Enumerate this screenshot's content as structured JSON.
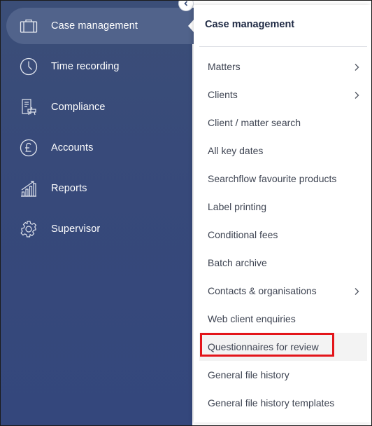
{
  "sidebar": {
    "items": [
      {
        "label": "Case management",
        "icon": "briefcase-icon",
        "active": true
      },
      {
        "label": "Time recording",
        "icon": "clock-icon",
        "active": false
      },
      {
        "label": "Compliance",
        "icon": "compliance-document-icon",
        "active": false
      },
      {
        "label": "Accounts",
        "icon": "pound-coin-icon",
        "active": false
      },
      {
        "label": "Reports",
        "icon": "bar-chart-icon",
        "active": false
      },
      {
        "label": "Supervisor",
        "icon": "gear-icon",
        "active": false
      }
    ]
  },
  "panel": {
    "title": "Case management",
    "items": [
      {
        "label": "Matters",
        "has_submenu": true
      },
      {
        "label": "Clients",
        "has_submenu": true
      },
      {
        "label": "Client / matter search",
        "has_submenu": false
      },
      {
        "label": "All key dates",
        "has_submenu": false
      },
      {
        "label": "Searchflow favourite products",
        "has_submenu": false
      },
      {
        "label": "Label printing",
        "has_submenu": false
      },
      {
        "label": "Conditional fees",
        "has_submenu": false
      },
      {
        "label": "Batch archive",
        "has_submenu": false
      },
      {
        "label": "Contacts & organisations",
        "has_submenu": true
      },
      {
        "label": "Web client enquiries",
        "has_submenu": false
      },
      {
        "label": "Questionnaires for review",
        "has_submenu": false,
        "highlighted": true
      },
      {
        "label": "General file history",
        "has_submenu": false
      },
      {
        "label": "General file history templates",
        "has_submenu": false
      }
    ]
  },
  "colors": {
    "sidebar_bg": "#3b4e78",
    "sidebar_active": "#51638b",
    "highlight_border": "#e3151a"
  }
}
